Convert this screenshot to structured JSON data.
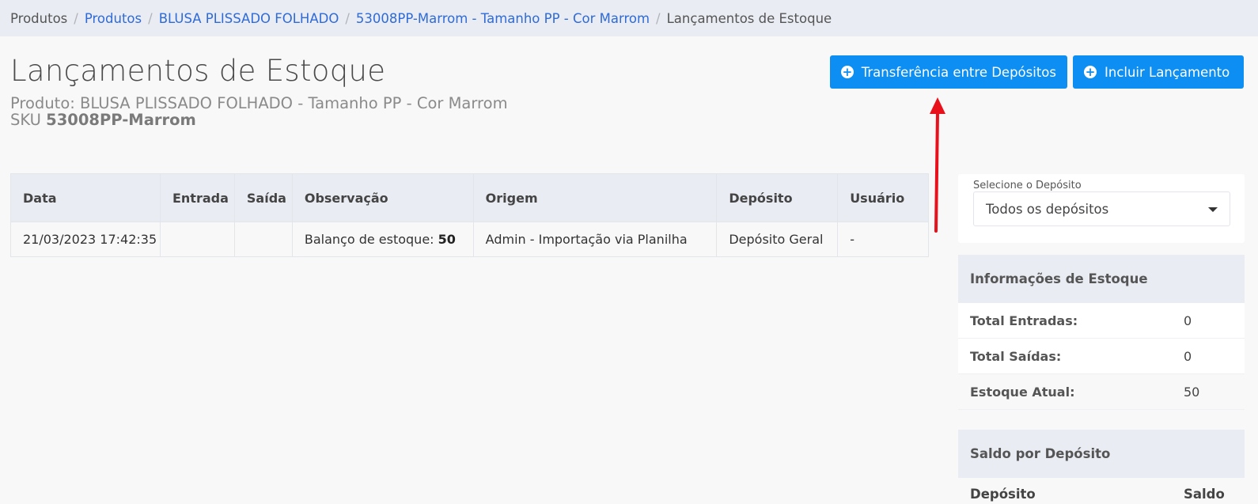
{
  "breadcrumb": [
    {
      "label": "Produtos",
      "link": false
    },
    {
      "label": "Produtos",
      "link": true
    },
    {
      "label": "BLUSA PLISSADO FOLHADO",
      "link": true
    },
    {
      "label": "53008PP-Marrom - Tamanho PP - Cor Marrom",
      "link": true
    },
    {
      "label": "Lançamentos de Estoque",
      "link": false
    }
  ],
  "header": {
    "title": "Lançamentos de Estoque",
    "product_line": "Produto: BLUSA PLISSADO FOLHADO - Tamanho PP - Cor Marrom",
    "sku_label": "SKU",
    "sku_value": "53008PP-Marrom"
  },
  "actions": {
    "transfer_label": "Transferência entre Depósitos",
    "include_label": "Incluir Lançamento",
    "accent_color": "#0d8ef2"
  },
  "table": {
    "columns": [
      "Data",
      "Entrada",
      "Saída",
      "Observação",
      "Origem",
      "Depósito",
      "Usuário"
    ],
    "rows": [
      {
        "data": "21/03/2023 17:42:35",
        "entrada": "",
        "saida": "",
        "observacao_prefix": "Balanço de estoque:",
        "observacao_value": "50",
        "origem": "Admin - Importação via Planilha",
        "deposito": "Depósito Geral",
        "usuario": "-"
      }
    ]
  },
  "deposit_filter": {
    "label": "Selecione o Depósito",
    "selected": "Todos os depósitos"
  },
  "stock_info": {
    "title": "Informações de Estoque",
    "rows": [
      {
        "label": "Total Entradas:",
        "value": "0"
      },
      {
        "label": "Total Saídas:",
        "value": "0"
      },
      {
        "label": "Estoque Atual:",
        "value": "50"
      }
    ]
  },
  "balance_by_deposit": {
    "title": "Saldo por Depósito",
    "col_deposit": "Depósito",
    "col_balance": "Saldo"
  },
  "annotation": {
    "arrow_color": "#e8101a"
  }
}
